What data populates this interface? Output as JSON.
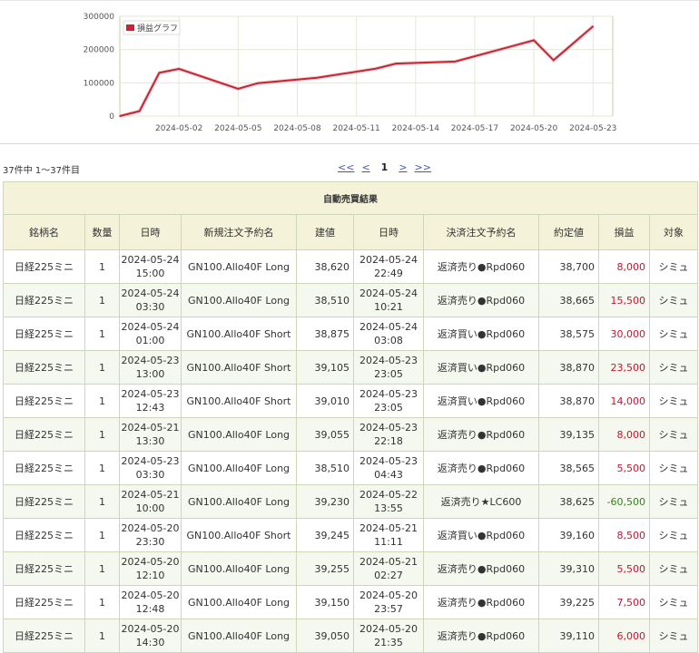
{
  "chart_data": {
    "type": "line",
    "legend": "損益グラフ",
    "ylim": [
      0,
      300000
    ],
    "y_ticks": [
      "300000",
      "200000",
      "100000",
      "0"
    ],
    "x_ticks": [
      "2024-05-02",
      "2024-05-05",
      "2024-05-08",
      "2024-05-11",
      "2024-05-14",
      "2024-05-17",
      "2024-05-20",
      "2024-05-23"
    ],
    "x_range": [
      "2024-04-29",
      "2024-05-24"
    ],
    "points": [
      {
        "x": "2024-04-29",
        "y": 0
      },
      {
        "x": "2024-04-30",
        "y": 15000
      },
      {
        "x": "2024-05-01",
        "y": 130000
      },
      {
        "x": "2024-05-02",
        "y": 142000
      },
      {
        "x": "2024-05-05",
        "y": 82000
      },
      {
        "x": "2024-05-06",
        "y": 99000
      },
      {
        "x": "2024-05-09",
        "y": 115000
      },
      {
        "x": "2024-05-12",
        "y": 143000
      },
      {
        "x": "2024-05-13",
        "y": 158000
      },
      {
        "x": "2024-05-16",
        "y": 164000
      },
      {
        "x": "2024-05-19",
        "y": 212000
      },
      {
        "x": "2024-05-20",
        "y": 228000
      },
      {
        "x": "2024-05-21",
        "y": 168000
      },
      {
        "x": "2024-05-23",
        "y": 270000
      }
    ],
    "line_color": "#cc2233",
    "grid": true,
    "legend_position": "top-left"
  },
  "pagination": {
    "count_text": "37件中 1～37件目",
    "first": "<<",
    "prev": "<",
    "current": "1",
    "next": ">",
    "last": ">>"
  },
  "table": {
    "caption": "自動売買結果",
    "headers": [
      "銘柄名",
      "数量",
      "日時",
      "新規注文予約名",
      "建値",
      "日時",
      "決済注文予約名",
      "約定値",
      "損益",
      "対象"
    ],
    "rows": [
      {
        "name": "日経225ミニ",
        "qty": "1",
        "date1": "2024-05-24",
        "time1": "15:00",
        "order": "GN100.Allo40F Long",
        "price": "38,620",
        "date2": "2024-05-24",
        "time2": "22:49",
        "settle": "返済売り●Rpd060",
        "exec": "38,700",
        "pl": "8,000",
        "target": "シミュ"
      },
      {
        "name": "日経225ミニ",
        "qty": "1",
        "date1": "2024-05-24",
        "time1": "03:30",
        "order": "GN100.Allo40F Long",
        "price": "38,510",
        "date2": "2024-05-24",
        "time2": "10:21",
        "settle": "返済売り●Rpd060",
        "exec": "38,665",
        "pl": "15,500",
        "target": "シミュ"
      },
      {
        "name": "日経225ミニ",
        "qty": "1",
        "date1": "2024-05-24",
        "time1": "01:00",
        "order": "GN100.Allo40F Short",
        "price": "38,875",
        "date2": "2024-05-24",
        "time2": "03:08",
        "settle": "返済買い●Rpd060",
        "exec": "38,575",
        "pl": "30,000",
        "target": "シミュ"
      },
      {
        "name": "日経225ミニ",
        "qty": "1",
        "date1": "2024-05-23",
        "time1": "13:00",
        "order": "GN100.Allo40F Short",
        "price": "39,105",
        "date2": "2024-05-23",
        "time2": "23:05",
        "settle": "返済買い●Rpd060",
        "exec": "38,870",
        "pl": "23,500",
        "target": "シミュ"
      },
      {
        "name": "日経225ミニ",
        "qty": "1",
        "date1": "2024-05-23",
        "time1": "12:43",
        "order": "GN100.Allo40F Short",
        "price": "39,010",
        "date2": "2024-05-23",
        "time2": "23:05",
        "settle": "返済買い●Rpd060",
        "exec": "38,870",
        "pl": "14,000",
        "target": "シミュ"
      },
      {
        "name": "日経225ミニ",
        "qty": "1",
        "date1": "2024-05-21",
        "time1": "13:30",
        "order": "GN100.Allo40F Long",
        "price": "39,055",
        "date2": "2024-05-23",
        "time2": "22:18",
        "settle": "返済売り●Rpd060",
        "exec": "39,135",
        "pl": "8,000",
        "target": "シミュ"
      },
      {
        "name": "日経225ミニ",
        "qty": "1",
        "date1": "2024-05-23",
        "time1": "03:30",
        "order": "GN100.Allo40F Long",
        "price": "38,510",
        "date2": "2024-05-23",
        "time2": "04:43",
        "settle": "返済売り●Rpd060",
        "exec": "38,565",
        "pl": "5,500",
        "target": "シミュ"
      },
      {
        "name": "日経225ミニ",
        "qty": "1",
        "date1": "2024-05-21",
        "time1": "10:00",
        "order": "GN100.Allo40F Long",
        "price": "39,230",
        "date2": "2024-05-22",
        "time2": "13:55",
        "settle": "返済売り★LC600",
        "exec": "38,625",
        "pl": "-60,500",
        "target": "シミュ"
      },
      {
        "name": "日経225ミニ",
        "qty": "1",
        "date1": "2024-05-20",
        "time1": "23:30",
        "order": "GN100.Allo40F Short",
        "price": "39,245",
        "date2": "2024-05-21",
        "time2": "11:11",
        "settle": "返済買い●Rpd060",
        "exec": "39,160",
        "pl": "8,500",
        "target": "シミュ"
      },
      {
        "name": "日経225ミニ",
        "qty": "1",
        "date1": "2024-05-20",
        "time1": "12:10",
        "order": "GN100.Allo40F Long",
        "price": "39,255",
        "date2": "2024-05-21",
        "time2": "02:27",
        "settle": "返済売り●Rpd060",
        "exec": "39,310",
        "pl": "5,500",
        "target": "シミュ"
      },
      {
        "name": "日経225ミニ",
        "qty": "1",
        "date1": "2024-05-20",
        "time1": "12:48",
        "order": "GN100.Allo40F Long",
        "price": "39,150",
        "date2": "2024-05-20",
        "time2": "23:57",
        "settle": "返済売り●Rpd060",
        "exec": "39,225",
        "pl": "7,500",
        "target": "シミュ"
      },
      {
        "name": "日経225ミニ",
        "qty": "1",
        "date1": "2024-05-20",
        "time1": "14:30",
        "order": "GN100.Allo40F Long",
        "price": "39,050",
        "date2": "2024-05-20",
        "time2": "21:35",
        "settle": "返済売り●Rpd060",
        "exec": "39,110",
        "pl": "6,000",
        "target": "シミュ"
      }
    ]
  }
}
